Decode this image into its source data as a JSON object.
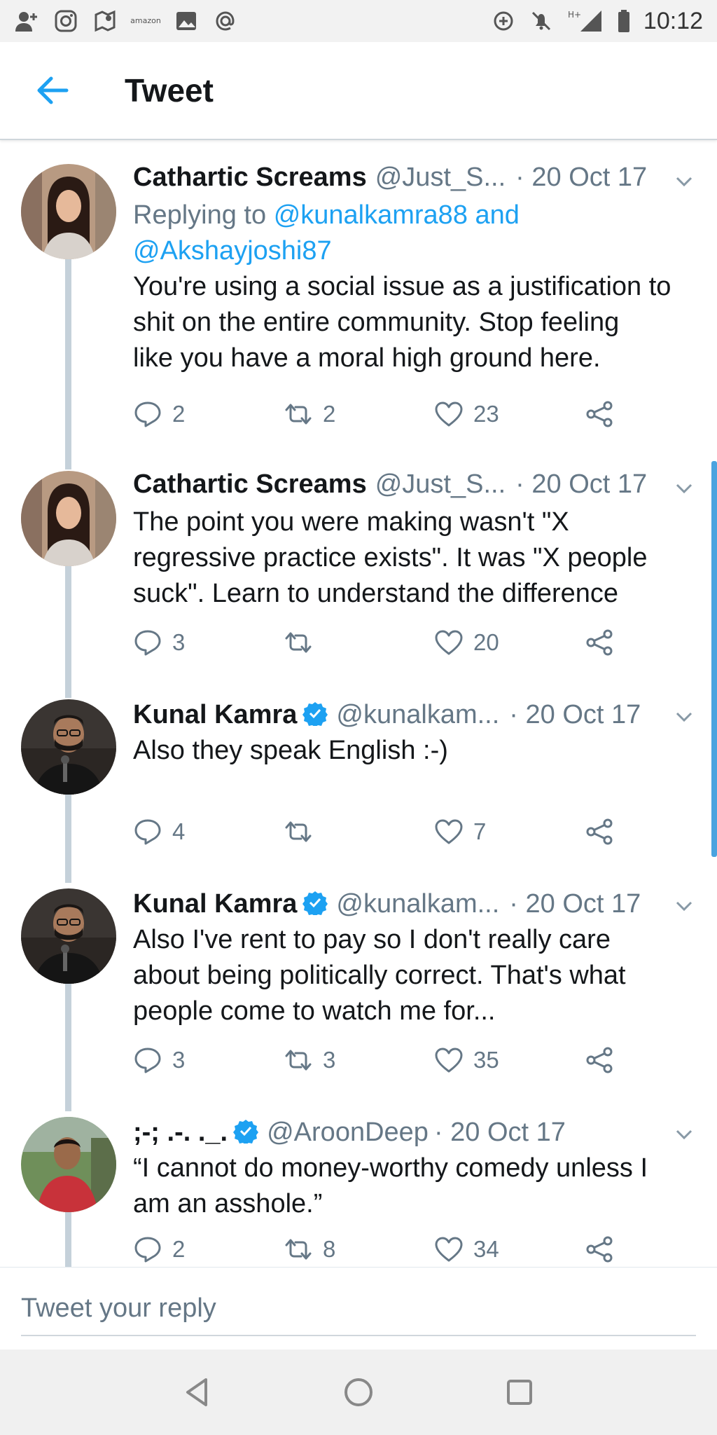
{
  "status_bar": {
    "time": "10:12",
    "amazon_label": "amazon",
    "left_icons": [
      "add-person-icon",
      "instagram-icon",
      "google-maps-icon",
      "amazon-icon",
      "image-icon",
      "at-sign-icon"
    ],
    "right_icons": [
      "data-saver-icon",
      "mute-icon",
      "signal-icon",
      "battery-icon"
    ],
    "network_label": "H+"
  },
  "header": {
    "title": "Tweet"
  },
  "tweets": [
    {
      "name": "Cathartic Screams",
      "verified": false,
      "handle": "@Just_S...",
      "date": "· 20 Oct 17",
      "replying_prefix": "Replying to",
      "replying_to_1": "@kunalkamra88",
      "replying_and": "and",
      "replying_to_2": "@Akshayjoshi87",
      "text_lines": [
        "You're using a social issue as a justification to",
        "shit on the entire community. Stop feeling",
        "like you have a moral high ground here."
      ],
      "replies": "2",
      "retweets": "2",
      "likes": "23"
    },
    {
      "name": "Cathartic Screams",
      "verified": false,
      "handle": "@Just_S...",
      "date": "· 20 Oct 17",
      "text_lines": [
        "The point you were making wasn't \"X",
        "regressive practice exists\". It was \"X people",
        "suck\". Learn to understand the difference"
      ],
      "replies": "3",
      "retweets": "",
      "likes": "20"
    },
    {
      "name": "Kunal Kamra",
      "verified": true,
      "handle": "@kunalkam...",
      "date": "· 20 Oct 17",
      "text_lines": [
        "Also they speak English :-)"
      ],
      "replies": "4",
      "retweets": "",
      "likes": "7"
    },
    {
      "name": "Kunal Kamra",
      "verified": true,
      "handle": "@kunalkam...",
      "date": "· 20 Oct 17",
      "text_lines": [
        "Also I've rent to pay so I don't really care",
        "about being politically correct. That's what",
        "people come to watch me for..."
      ],
      "replies": "3",
      "retweets": "3",
      "likes": "35"
    },
    {
      "name": ";-; .-. ._.",
      "verified": true,
      "handle": "@AroonDeep",
      "date": "· 20 Oct 17",
      "text_lines": [
        "“I cannot do money-worthy comedy unless I",
        "am an asshole.”"
      ],
      "replies": "2",
      "retweets": "8",
      "likes": "34"
    }
  ],
  "reply_bar": {
    "placeholder": "Tweet your reply"
  },
  "colors": {
    "accent": "#1da1f2",
    "secondary_text": "#657786",
    "thread_line": "#c5d1da",
    "nav_bar": "#f0f0f0"
  }
}
